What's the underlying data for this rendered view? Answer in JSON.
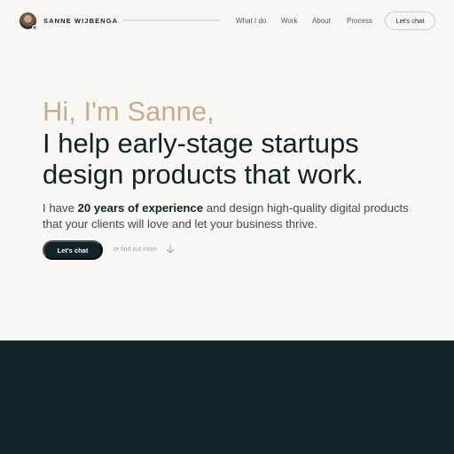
{
  "header": {
    "brand": "SANNE WIJBENGA",
    "scroll_progress": 0.0,
    "nav": [
      "What I do",
      "Work",
      "About",
      "Process"
    ],
    "chat_label": "Let's chat"
  },
  "hero": {
    "greeting": "Hi, I'm Sanne,",
    "title_line1": "I help early-stage startups",
    "title_line2": "design products that work.",
    "sub_before": "I have ",
    "sub_bold": "20 years of experience",
    "sub_after": " and design high-quality digital products that your clients will love and let your business thrive.",
    "cta_label": "Let's chat",
    "more_label": "or find out more"
  },
  "icons": {
    "avatar": "avatar-photo",
    "status": "online-dot",
    "arrow": "arrow-down-icon"
  },
  "colors": {
    "background": "#f9f7f3",
    "primary": "#0f2328",
    "accent": "#c6ad8f",
    "online": "#3ec08a"
  }
}
